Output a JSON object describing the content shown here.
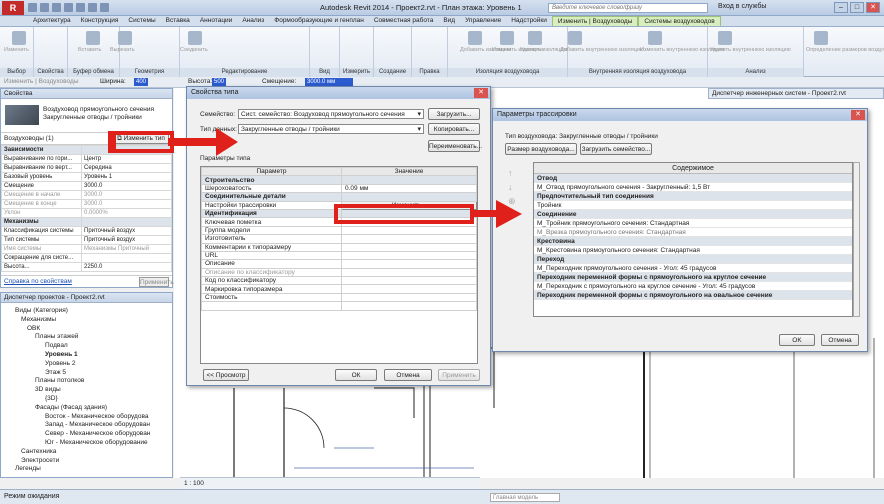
{
  "app": {
    "title": "Autodesk Revit 2014 -    Проект2.rvt - План этажа: Уровень 1",
    "search_placeholder": "Введите ключевое слово/фразу",
    "login": "Вход в службы",
    "status": "Режим ожидания",
    "view_scale": "1 : 100",
    "main_model": "Главная модель"
  },
  "tabs": [
    "Архитектура",
    "Конструкция",
    "Системы",
    "Вставка",
    "Аннотации",
    "Анализ",
    "Формообразующие и генплан",
    "Совместная работа",
    "Вид",
    "Управление",
    "Надстройки",
    "Изменить | Воздуховоды",
    "Системы воздуховодов"
  ],
  "ribbon_groups": [
    "Выбор",
    "Свойства",
    "Буфер обмена",
    "Геометрия",
    "Редактирование",
    "Вид",
    "Измерить",
    "Создание",
    "Правка",
    "Изоляция воздуховода",
    "Внутренняя изоляция воздуховода",
    "Анализ"
  ],
  "ribbon_buttons": [
    "Изменить",
    "Вставить",
    "Вырезать",
    "Соединить",
    "Добавить изоляцию",
    "Изменить изоляцию",
    "Удалить изоляцию",
    "Добавить внутреннюю изоляцию",
    "Изменить внутреннюю изоляцию",
    "Удалить внутреннюю изоляцию",
    "Определение размеров воздуховодов/труб"
  ],
  "optbar": {
    "modify_label": "Изменить | Воздуховоды",
    "width_label": "Ширина:",
    "width_value": "400",
    "height_label": "Высота:",
    "height_value": "500",
    "offset_label": "Смещение:",
    "offset_value": "3000.0 мм"
  },
  "properties": {
    "title": "Свойства",
    "type_line1": "Воздуховод прямоугольного сечения",
    "type_line2": "Закругленные отводы / тройники",
    "instance_label": "Воздуховоды (1)",
    "edit_type": "Изменить тип",
    "rows": [
      [
        "Зависимости",
        ""
      ],
      [
        "Выравнивание по гори...",
        "Центр"
      ],
      [
        "Выравнивание по верт...",
        "Середина"
      ],
      [
        "Базовый уровень",
        "Уровень 1"
      ],
      [
        "Смещение",
        "3000.0"
      ],
      [
        "Смещение в начале",
        "3000.0"
      ],
      [
        "Смещение в конце",
        "3000.0"
      ],
      [
        "Уклон",
        "0.0000%"
      ],
      [
        "Механизмы",
        ""
      ],
      [
        "Классификация системы",
        "Приточный воздух"
      ],
      [
        "Тип системы",
        "Приточный воздух"
      ],
      [
        "Имя системы",
        "Механизмы Приточный"
      ],
      [
        "Сокращение для систе...",
        ""
      ],
      [
        "Высота...",
        "2250.0"
      ]
    ],
    "help_link": "Справка по свойствам",
    "apply": "Применить"
  },
  "browser": {
    "title": "Диспетчер проектов - Проект2.rvt",
    "items": [
      "Виды (Категория)",
      "Механизмы",
      "ОВК",
      "Планы этажей",
      "Подвал",
      "Уровень 1",
      "Уровень 2",
      "Этаж 5",
      "Планы потолков",
      "3D виды",
      "{3D}",
      "Фасады (Фасад здания)",
      "Восток - Механическое оборудова",
      "Запад - Механическое оборудован",
      "Север - Механическое оборудован",
      "Юг - Механическое оборудование",
      "Сантехника",
      "Электросети",
      "Легенды"
    ]
  },
  "system_browser_title": "Диспетчер инженерных систем - Проект2.rvt",
  "type_dialog": {
    "title": "Свойства типа",
    "family_label": "Семейство:",
    "family_value": "Сист. семейство: Воздуховод прямоугольного сечения",
    "type_label": "Тип данных:",
    "type_value": "Закругленные отводы / тройники",
    "load": "Загрузить...",
    "copy": "Копировать...",
    "rename": "Переименовать...",
    "params_label": "Параметры типа",
    "col_param": "Параметр",
    "col_value": "Значение",
    "rows": [
      [
        "Строительство",
        "",
        "sec"
      ],
      [
        "Шероховатость",
        "0.09 мм",
        ""
      ],
      [
        "Соединительные детали",
        "",
        "sec"
      ],
      [
        "Настройки трассировки",
        "Изменить...",
        "btn"
      ],
      [
        "Идентификация",
        "",
        "sec"
      ],
      [
        "Ключевая пометка",
        "",
        ""
      ],
      [
        "Группа модели",
        "",
        ""
      ],
      [
        "Изготовитель",
        "",
        ""
      ],
      [
        "Комментарии к типоразмеру",
        "",
        ""
      ],
      [
        "URL",
        "",
        ""
      ],
      [
        "Описание",
        "",
        ""
      ],
      [
        "Описание по классификатору",
        "",
        "dis"
      ],
      [
        "Код по классификатору",
        "",
        ""
      ],
      [
        "Маркировка типоразмера",
        "",
        ""
      ],
      [
        "Стоимость",
        "",
        ""
      ]
    ],
    "preview": "<< Просмотр",
    "ok": "ОК",
    "cancel": "Отмена",
    "apply": "Применить"
  },
  "routing_dialog": {
    "title": "Параметры трассировки",
    "duct_type": "Тип воздуховода: Закругленные отводы / тройники",
    "size_btn": "Размер воздуховода...",
    "load_family": "Загрузить семейство...",
    "col": "Содержимое",
    "rows": [
      [
        "Отвод",
        "sec"
      ],
      [
        "М_Отвод прямоугольного сечения - Закругленный: 1,5 Вт",
        ""
      ],
      [
        "Предпочтительный тип соединения",
        "sec"
      ],
      [
        "Тройник",
        ""
      ],
      [
        "Соединение",
        "sec"
      ],
      [
        "М_Тройник прямоугольного сечения: Стандартная",
        ""
      ],
      [
        "М_Врезка прямоугольного сечения: Стандартная",
        "gray"
      ],
      [
        "Крестовина",
        "sec"
      ],
      [
        "М_Крестовина прямоугольного сечения: Стандартная",
        ""
      ],
      [
        "Переход",
        "sec"
      ],
      [
        "М_Переходник прямоугольного сечения - Угол: 45 градусов",
        ""
      ],
      [
        "Переходник переменной формы с прямоугольного на круглое сечение",
        "sec"
      ],
      [
        "М_Переходник с прямоугольного на круглое сечение - Угол: 45 градусов",
        ""
      ],
      [
        "Переходник переменной формы с прямоугольного на овальное сечение",
        "sec"
      ]
    ],
    "ok": "OK",
    "cancel": "Отмена"
  }
}
